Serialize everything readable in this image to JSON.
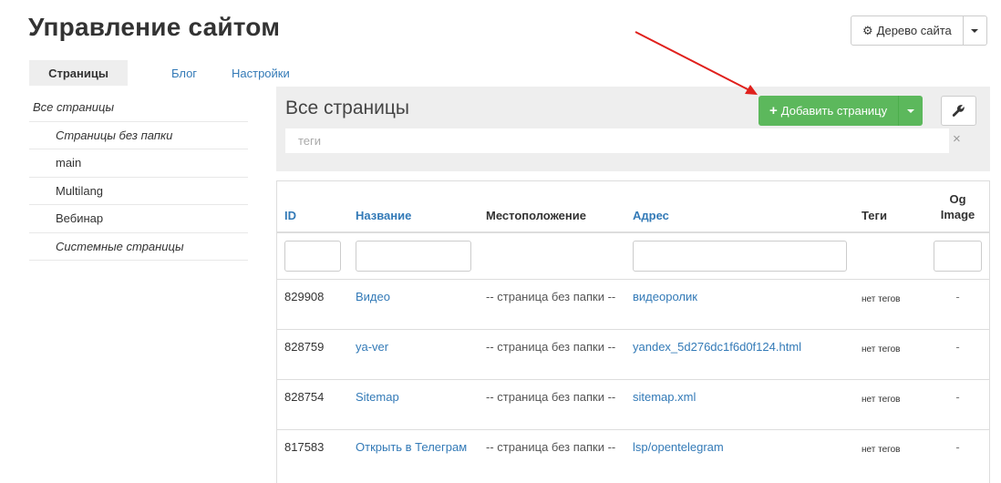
{
  "page": {
    "title": "Управление сайтом"
  },
  "tree_button": {
    "label": "Дерево сайта",
    "icon": "gear-icon"
  },
  "tabs": [
    {
      "label": "Страницы",
      "active": true
    },
    {
      "label": "Блог",
      "active": false
    },
    {
      "label": "Настройки",
      "active": false
    }
  ],
  "sidebar": {
    "items": [
      {
        "label": "Все страницы"
      },
      {
        "label": "Страницы без папки"
      },
      {
        "label": "main"
      },
      {
        "label": "Multilang"
      },
      {
        "label": "Вебинар"
      },
      {
        "label": "Системные страницы"
      }
    ]
  },
  "main": {
    "title": "Все страницы",
    "add_button": {
      "label": "Добавить страницу",
      "icon": "plus-icon"
    },
    "tools_icon": "wrench-icon",
    "tags_filter": {
      "placeholder": "теги",
      "clear": "×"
    }
  },
  "table": {
    "headers": {
      "id": "ID",
      "name": "Название",
      "location": "Местоположение",
      "address": "Адрес",
      "tags": "Теги",
      "og1": "Og",
      "og2": "Image"
    },
    "rows": [
      {
        "id": "829908",
        "name": "Видео",
        "location": "-- страница без папки --",
        "address": "видеоролик",
        "tags": "нет тегов",
        "og": "-"
      },
      {
        "id": "828759",
        "name": "ya-ver",
        "location": "-- страница без папки --",
        "address": "yandex_5d276dc1f6d0f124.html",
        "tags": "нет тегов",
        "og": "-"
      },
      {
        "id": "828754",
        "name": "Sitemap",
        "location": "-- страница без папки --",
        "address": "sitemap.xml",
        "tags": "нет тегов",
        "og": "-"
      },
      {
        "id": "817583",
        "name": "Открыть в Телеграм",
        "location": "-- страница без папки --",
        "address": "lsp/opentelegram",
        "tags": "нет тегов",
        "og": "-"
      }
    ]
  },
  "colors": {
    "link": "#337ab7",
    "success": "#5cb85c",
    "arrow": "#e0201c",
    "panel": "#eeeeee"
  }
}
